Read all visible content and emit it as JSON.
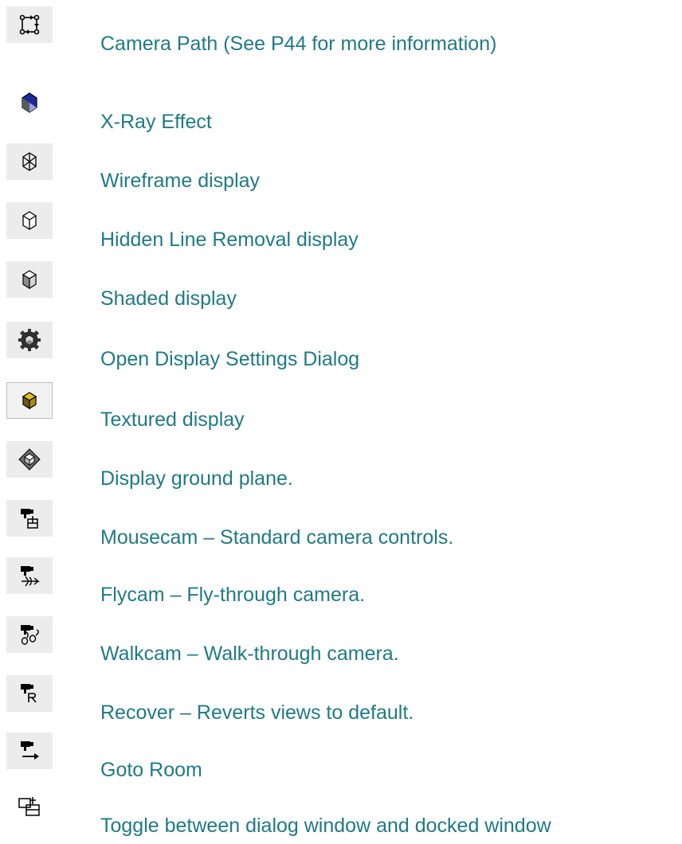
{
  "items": [
    {
      "icon": "camera-path-icon",
      "label": "Camera Path (See P44 for more information)"
    },
    {
      "icon": "xray-effect-icon",
      "label": "X-Ray Effect"
    },
    {
      "icon": "wireframe-icon",
      "label": "Wireframe display"
    },
    {
      "icon": "hidden-line-icon",
      "label": "Hidden Line Removal display"
    },
    {
      "icon": "shaded-icon",
      "label": "Shaded display"
    },
    {
      "icon": "display-settings-icon",
      "label": "Open Display Settings Dialog"
    },
    {
      "icon": "textured-icon",
      "label": "Textured display"
    },
    {
      "icon": "ground-plane-icon",
      "label": "Display ground plane."
    },
    {
      "icon": "mousecam-icon",
      "label": "Mousecam – Standard camera controls."
    },
    {
      "icon": "flycam-icon",
      "label": "Flycam – Fly-through camera."
    },
    {
      "icon": "walkcam-icon",
      "label": "Walkcam – Walk-through camera."
    },
    {
      "icon": "recover-icon",
      "label": "Recover – Reverts views to default."
    },
    {
      "icon": "goto-room-icon",
      "label": "Goto Room"
    },
    {
      "icon": "toggle-dock-icon",
      "label": "Toggle between dialog window and docked window"
    }
  ]
}
